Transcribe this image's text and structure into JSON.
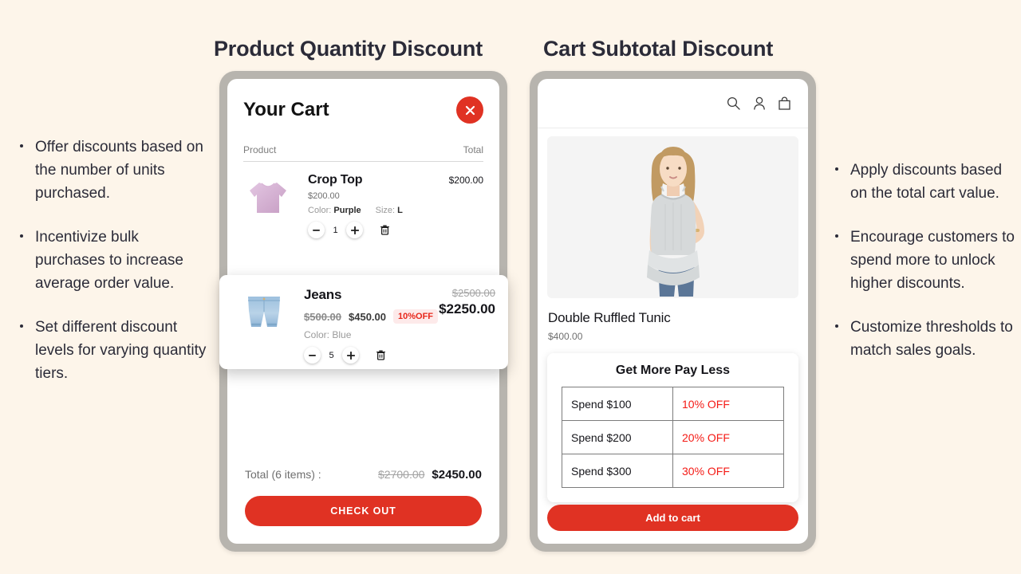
{
  "theme": {
    "background": "#fdf5ea",
    "accent_red": "#e03223",
    "text_dark": "#2b2b38",
    "frame_gray": "#b7b4ae",
    "badge_red": "#e8271b"
  },
  "left_section": {
    "heading": "Product Quantity Discount",
    "bullets": [
      "Offer discounts based on the number of units purchased.",
      "Incentivize bulk purchases to increase average order value.",
      "Set different discount levels for varying quantity tiers."
    ]
  },
  "right_section": {
    "heading": "Cart Subtotal Discount",
    "bullets": [
      "Apply discounts based on the total cart value.",
      "Encourage customers to spend more to unlock higher discounts.",
      "Customize thresholds to match sales goals."
    ]
  },
  "cart": {
    "title": "Your Cart",
    "close_icon": "close-x-icon",
    "columns": {
      "product": "Product",
      "total": "Total"
    },
    "items": [
      {
        "name": "Crop Top",
        "unit_price": "$200.00",
        "options": [
          {
            "label": "Color:",
            "value": "Purple"
          },
          {
            "label": "Size:",
            "value": "L"
          }
        ],
        "quantity": "1",
        "line_total": "$200.00",
        "thumb": "crop-top-thumb"
      }
    ],
    "highlighted_item": {
      "name": "Jeans",
      "original_price": "$500.00",
      "discounted_price": "$450.00",
      "discount_badge": "10%OFF",
      "options": [
        {
          "label": "Color:",
          "value": "Blue"
        }
      ],
      "quantity": "5",
      "line_total_original": "$2500.00",
      "line_total_discounted": "$2250.00",
      "thumb": "jeans-thumb"
    },
    "footer": {
      "total_label": "Total (6 items) :",
      "total_original": "$2700.00",
      "total_discounted": "$2450.00",
      "checkout_label": "CHECK OUT"
    },
    "stepper": {
      "minus": "minus-icon",
      "plus": "plus-icon",
      "delete": "trash-icon"
    }
  },
  "pdp": {
    "header_icons": [
      "search-icon",
      "account-icon",
      "shopping-bag-icon"
    ],
    "hero_image": "model-wearing-tunic",
    "product_name": "Double Ruffled Tunic",
    "product_price": "$400.00",
    "tier_card": {
      "title": "Get More Pay Less",
      "rows": [
        {
          "spend": "Spend $100",
          "off": "10% OFF"
        },
        {
          "spend": "Spend $200",
          "off": "20% OFF"
        },
        {
          "spend": "Spend $300",
          "off": "30% OFF"
        }
      ]
    },
    "add_to_cart_label": "Add to cart"
  }
}
